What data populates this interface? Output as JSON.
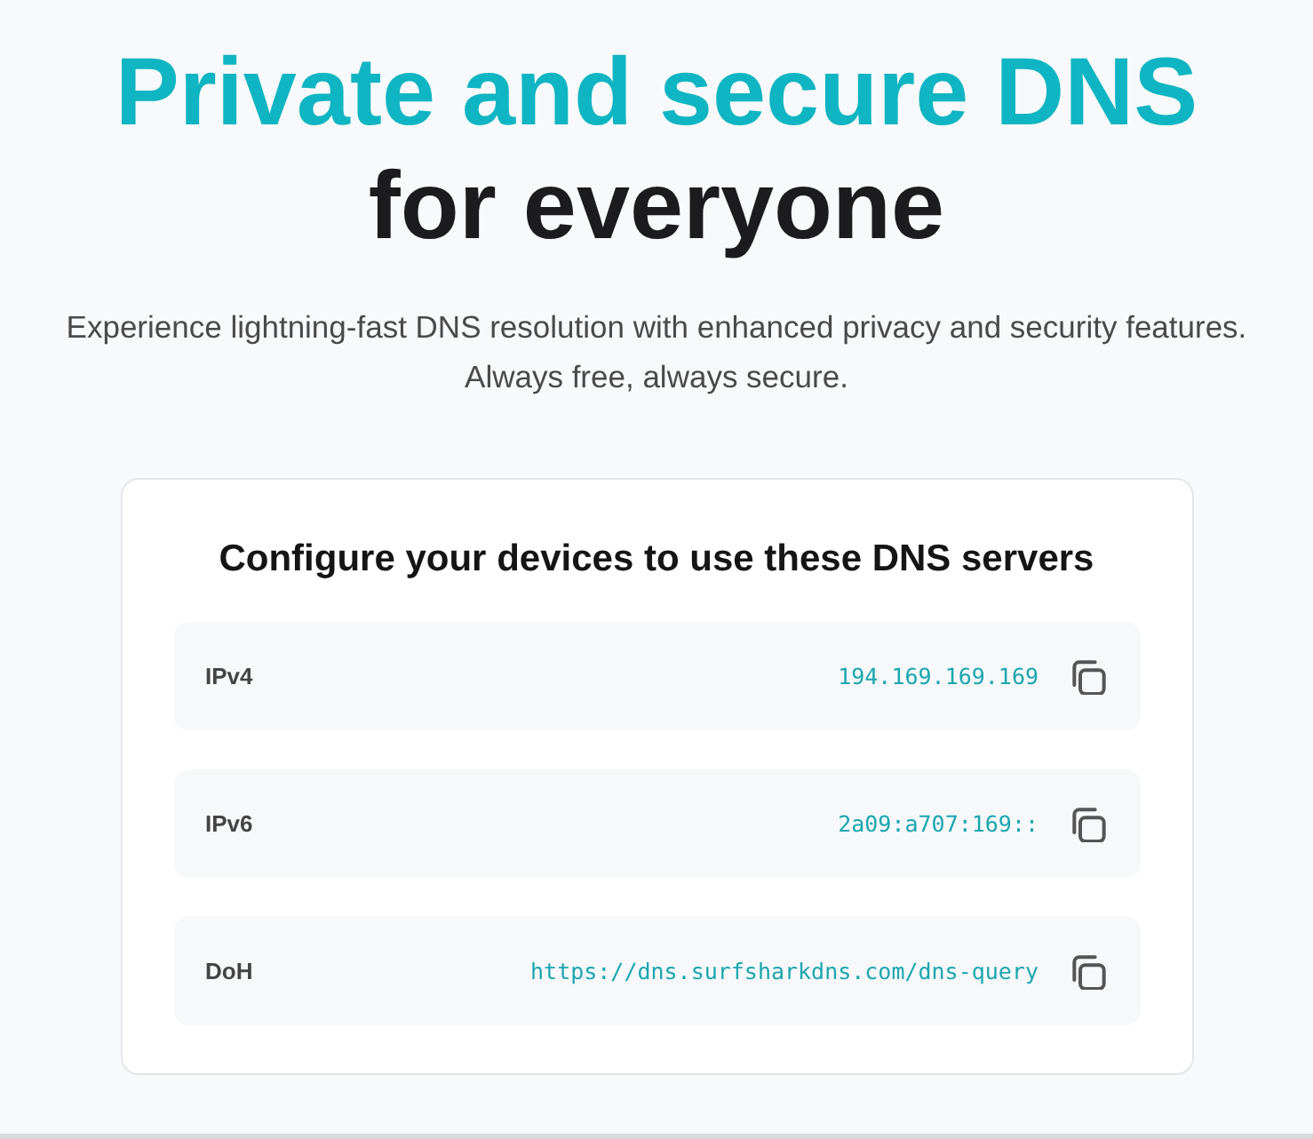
{
  "hero": {
    "title_line_1": "Private and secure DNS",
    "title_line_2": "for everyone",
    "subtitle": "Experience lightning-fast DNS resolution with enhanced privacy and security features. Always free, always secure."
  },
  "card": {
    "heading": "Configure your devices to use these DNS servers",
    "servers": [
      {
        "label": "IPv4",
        "address": "194.169.169.169"
      },
      {
        "label": "IPv6",
        "address": "2a09:a707:169::"
      },
      {
        "label": "DoH",
        "address": "https://dns.surfsharkdns.com/dns-query"
      }
    ]
  }
}
